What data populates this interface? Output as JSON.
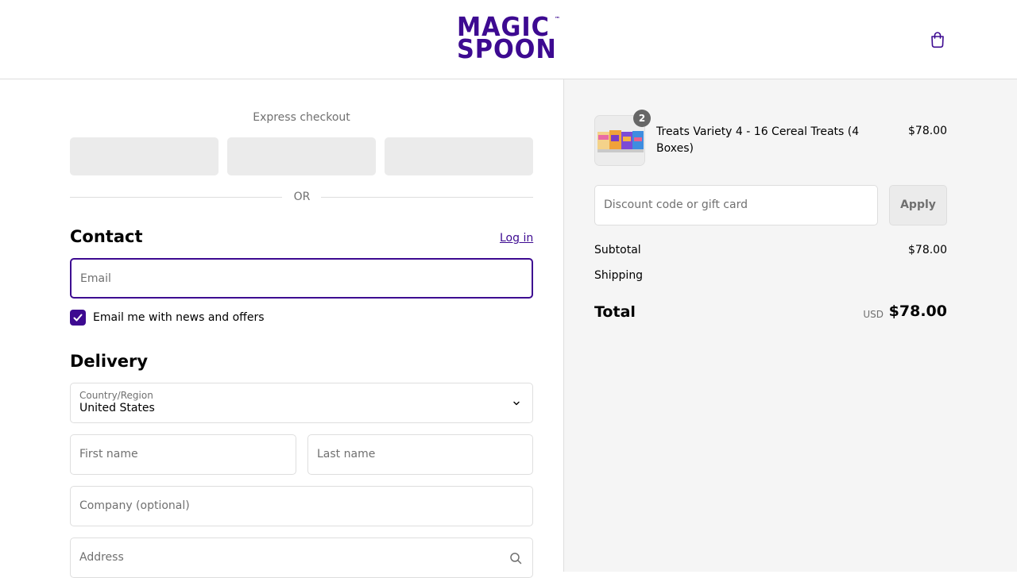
{
  "header": {
    "logo_line1": "MAGIC",
    "logo_line2": "SPOON",
    "logo_tm": "™",
    "cart_icon": "shopping-bag-icon"
  },
  "colors": {
    "brand": "#3d0a91",
    "panel_bg": "#f5f5f5",
    "border": "#dedede",
    "muted_text": "#707070"
  },
  "express": {
    "title": "Express checkout",
    "divider": "OR"
  },
  "contact": {
    "heading": "Contact",
    "login_label": "Log in",
    "email_placeholder": "Email",
    "newsletter_label": "Email me with news and offers",
    "newsletter_checked": true
  },
  "delivery": {
    "heading": "Delivery",
    "country_label": "Country/Region",
    "country_value": "United States",
    "first_name_placeholder": "First name",
    "last_name_placeholder": "Last name",
    "company_placeholder": "Company (optional)",
    "address_placeholder": "Address"
  },
  "summary": {
    "item": {
      "quantity": "2",
      "name": "Treats Variety 4 - 16 Cereal Treats (4 Boxes)",
      "price": "$78.00"
    },
    "discount_placeholder": "Discount code or gift card",
    "apply_label": "Apply",
    "subtotal_label": "Subtotal",
    "subtotal_value": "$78.00",
    "shipping_label": "Shipping",
    "total_label": "Total",
    "total_currency": "USD",
    "total_value": "$78.00"
  }
}
